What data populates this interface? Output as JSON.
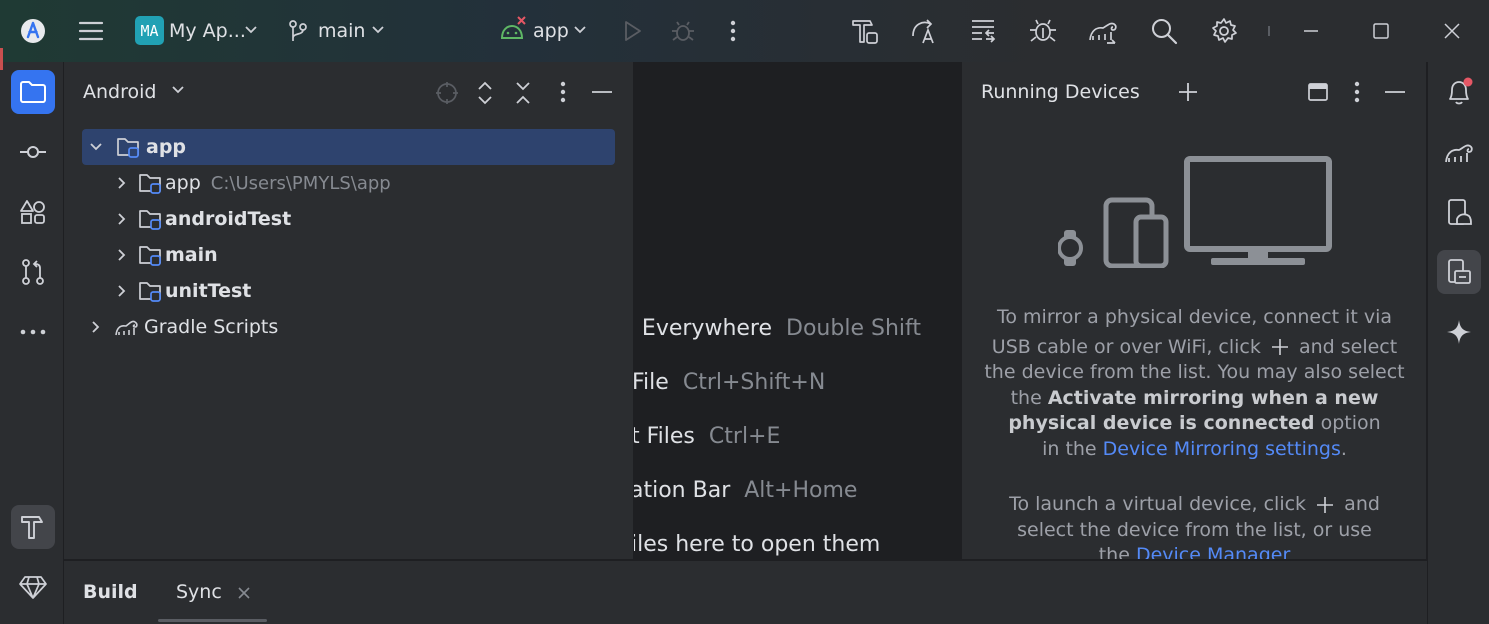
{
  "titlebar": {
    "project_badge": "MA",
    "project_name": "My Ap...",
    "branch": "main",
    "run_config": "app"
  },
  "project_panel": {
    "view_selector": "Android",
    "tree": [
      {
        "label": "app",
        "expanded": true,
        "selected": true
      },
      {
        "label": "app",
        "path": "C:\\Users\\PMYLS\\app"
      },
      {
        "label": "androidTest"
      },
      {
        "label": "main"
      },
      {
        "label": "unitTest"
      },
      {
        "label": "Gradle Scripts"
      }
    ]
  },
  "editor": {
    "hints": [
      {
        "action": "n Everywhere",
        "shortcut": "Double Shift"
      },
      {
        "action": "File",
        "shortcut": "Ctrl+Shift+N"
      },
      {
        "action": "t Files",
        "shortcut": "Ctrl+E"
      },
      {
        "action": "ation Bar",
        "shortcut": "Alt+Home"
      },
      {
        "action": "iles here to open them",
        "shortcut": ""
      }
    ]
  },
  "running_devices": {
    "title": "Running Devices",
    "mirror_line1": "To mirror a physical device, connect it via",
    "mirror_line2a": "USB cable or over WiFi, click",
    "mirror_line2b": "and select",
    "mirror_line3": "the device from the list. You may also select",
    "mirror_line4a": "the",
    "mirror_bold1": "Activate mirroring when a new",
    "mirror_bold2": "physical device is connected",
    "mirror_line5b": "option",
    "mirror_line6a": "in the",
    "mirror_link": "Device Mirroring settings",
    "mirror_line6b": ".",
    "virtual_line1a": "To launch a virtual device, click",
    "virtual_line1b": "and",
    "virtual_line2": "select the device from the list, or use",
    "virtual_line3a": "the",
    "virtual_link": "Device Manager"
  },
  "bottom_tabs": {
    "build": "Build",
    "sync": "Sync"
  },
  "colors": {
    "accent": "#3574f0",
    "selection": "#2e436e",
    "link": "#548af7",
    "badge": "#21a1b4",
    "notification_dot": "#e55765"
  }
}
